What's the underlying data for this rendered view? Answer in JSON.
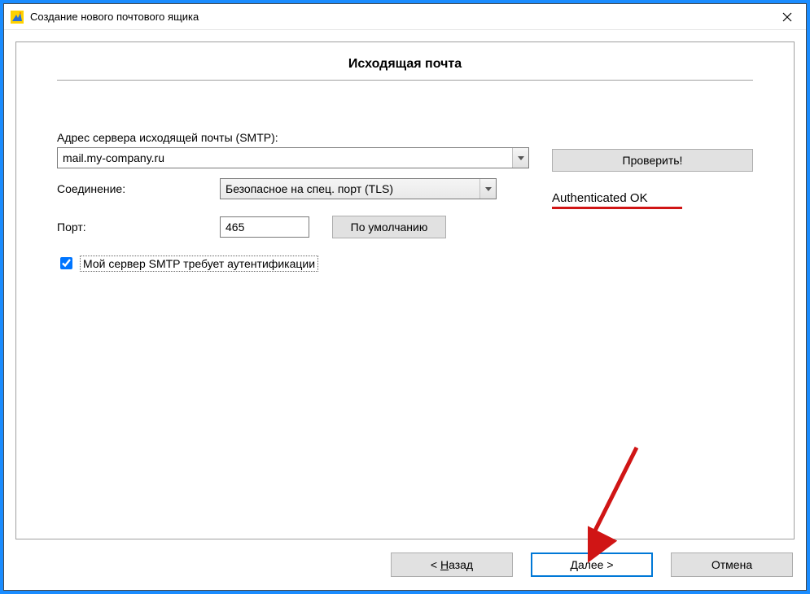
{
  "window": {
    "title": "Создание нового почтового ящика"
  },
  "page": {
    "title": "Исходящая почта"
  },
  "form": {
    "smtp_label": "Адрес сервера исходящей почты (SMTP):",
    "smtp_value": "mail.my-company.ru",
    "connection_label": "Соединение:",
    "connection_value": "Безопасное на спец. порт (TLS)",
    "port_label": "Порт:",
    "port_value": "465",
    "default_button": "По умолчанию",
    "auth_checkbox_label": "Мой сервер SMTP требует аутентификации",
    "auth_checked": true
  },
  "test": {
    "button_label": "Проверить!",
    "status_text": "Authenticated OK"
  },
  "wizard": {
    "back_prefix": "<  ",
    "back_u": "Н",
    "back_rest": "азад",
    "next_u": "Д",
    "next_rest": "алее   >",
    "cancel": "Отмена"
  }
}
